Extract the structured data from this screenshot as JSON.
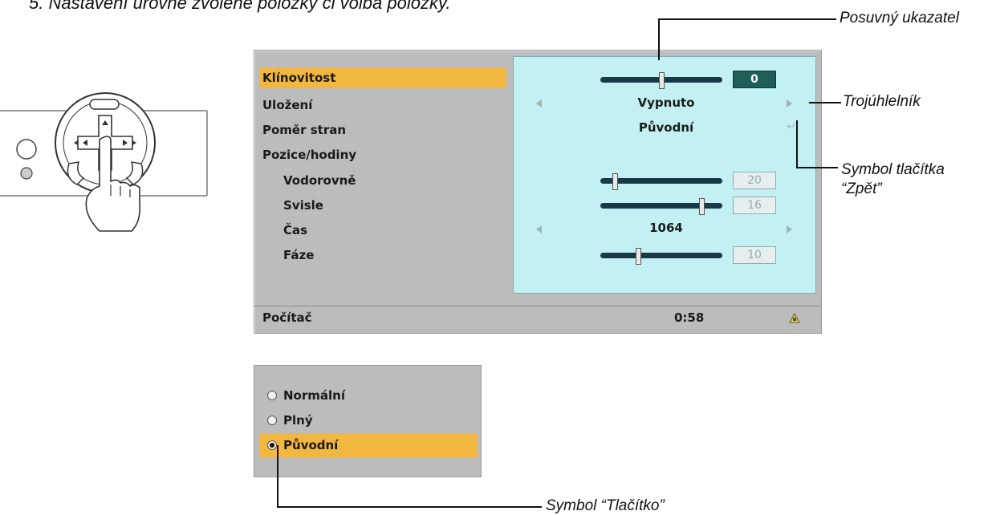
{
  "heading": "5. Nastavení úrovně zvolené položky či volba položky.",
  "callouts": {
    "slider": "Posuvný ukazatel",
    "triangle": "Trojúhlelník",
    "return_line1": "Symbol tlačítka",
    "return_line2": "“Zpět”",
    "radio": "Symbol “Tlačítko”"
  },
  "menu": {
    "rows": [
      {
        "label": "Klínovitost",
        "selected": true
      },
      {
        "label": "Uložení"
      },
      {
        "label": "Poměr stran"
      },
      {
        "label": "Pozice/hodiny"
      },
      {
        "label": "Vodorovně"
      },
      {
        "label": "Svisle"
      },
      {
        "label": "Čas"
      },
      {
        "label": "Fáze"
      }
    ],
    "values": {
      "klinovitost": "0",
      "ulozeni": "Vypnuto",
      "pomer_stran": "Původní",
      "vodorovne": "20",
      "svisle": "16",
      "cas": "1064",
      "faze": "10"
    },
    "slider_levels": {
      "klinovitost": 0.5,
      "vodorovne": 0.1,
      "svisle": 0.85,
      "faze": 0.3
    },
    "status": {
      "source": "Počítač",
      "time": "0:58"
    }
  },
  "options": [
    {
      "label": "Normální",
      "checked": false
    },
    {
      "label": "Plný",
      "checked": false
    },
    {
      "label": "Původní",
      "checked": true
    }
  ],
  "colors": {
    "highlight": "#f2b740",
    "panel": "#c3f0f2",
    "menu_bg": "#bcbcbc",
    "slider": "#183a48",
    "active_box": "#1d5e58"
  }
}
